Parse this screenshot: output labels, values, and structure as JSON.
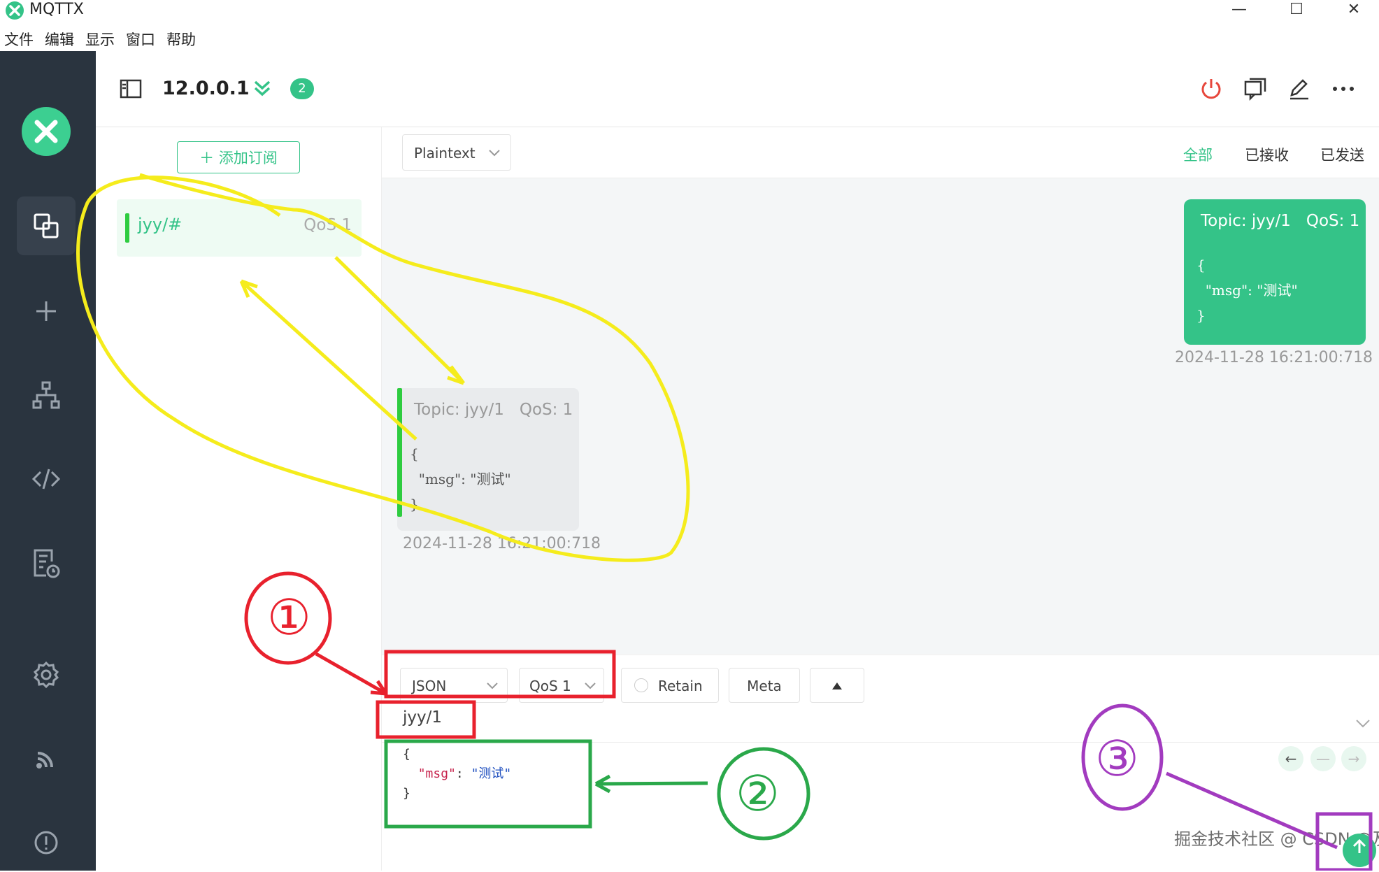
{
  "window": {
    "title": "MQTTX",
    "controls": {
      "minimize": "—",
      "maximize": "☐",
      "close": "✕"
    }
  },
  "menu": [
    "文件",
    "编辑",
    "显示",
    "窗口",
    "帮助"
  ],
  "sidebar": {
    "logo": "mqttx-logo-icon",
    "items": [
      {
        "name": "connections-icon",
        "active": true
      },
      {
        "name": "add-icon"
      },
      {
        "name": "topology-icon"
      },
      {
        "name": "script-icon"
      },
      {
        "name": "log-icon"
      },
      {
        "name": "settings-icon"
      },
      {
        "name": "rss-icon"
      },
      {
        "name": "about-icon"
      }
    ]
  },
  "header": {
    "connection_name": "12.0.0.1",
    "status_icon": "double-chevron-down-icon",
    "subscription_count": "2",
    "actions": [
      "power-icon",
      "new-window-icon",
      "edit-icon",
      "more-icon"
    ]
  },
  "subscriptions": {
    "add_label": "添加订阅",
    "items": [
      {
        "topic": "jyy/#",
        "qos": "QoS 1",
        "color": "#2ecc40"
      }
    ]
  },
  "messages": {
    "payload_type": "Plaintext",
    "filters": [
      "全部",
      "已接收",
      "已发送"
    ],
    "received": {
      "topic": "Topic: jyy/1",
      "qos": "QoS: 1",
      "payload_lines": [
        "{",
        "  \"msg\": \"测试\"",
        "}"
      ],
      "time": "2024-11-28 16:21:00:718"
    },
    "sent": {
      "topic": "Topic: jyy/1",
      "qos": "QoS: 1",
      "payload_lines": [
        "{",
        "  \"msg\": \"测试\"",
        "}"
      ],
      "time": "2024-11-28 16:21:00:718"
    }
  },
  "publish": {
    "format": "JSON",
    "qos": "QoS 1",
    "retain": "Retain",
    "meta": "Meta",
    "topic": "jyy/1",
    "payload": {
      "open": "{",
      "key": "\"msg\"",
      "colon": ": ",
      "value": "\"测试\"",
      "close": "}"
    }
  },
  "annotations": {
    "circle_1": "①",
    "circle_2": "②",
    "circle_3": "③"
  },
  "watermark": "掘金技术社区 @ CSDN @及了了",
  "colors": {
    "accent": "#34c388",
    "sidebar": "#2a343f",
    "annotation_red": "#e8212d",
    "annotation_green": "#2aa84a",
    "annotation_purple": "#a23bbf",
    "annotation_yellow": "#f5ec1c"
  }
}
